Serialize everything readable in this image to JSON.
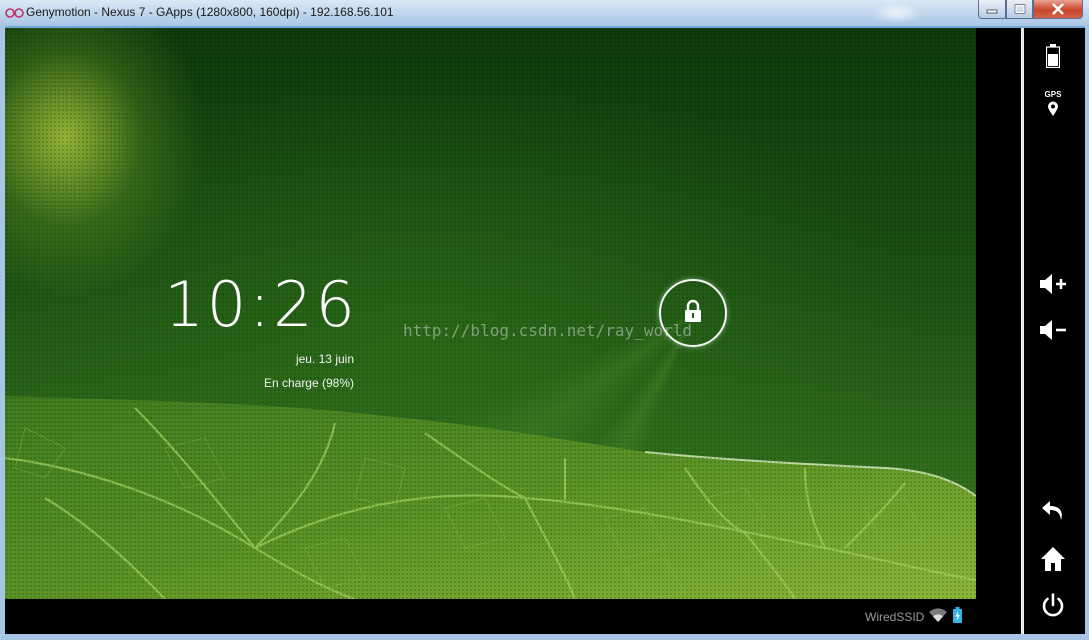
{
  "window": {
    "title": "Genymotion - Nexus 7 - GApps (1280x800, 160dpi) - 192.168.56.101"
  },
  "lockscreen": {
    "time": "10:26",
    "date": "jeu. 13 juin",
    "charging": "En charge (98%)",
    "watermark": "http://blog.csdn.net/ray_world"
  },
  "statusbar": {
    "ssid": "WiredSSID"
  },
  "sidebar": {
    "gps_label": "GPS"
  },
  "colors": {
    "titlebar": "#c4d8ee",
    "close_button": "#c9462c",
    "screen_green": "#1d5214",
    "sidebar_bg": "#000000"
  },
  "icons": [
    "genymotion-logo-icon",
    "minimize-icon",
    "maximize-icon",
    "close-icon",
    "lock-icon",
    "wifi-icon",
    "battery-charging-icon",
    "battery-icon",
    "gps-icon",
    "volume-up-icon",
    "volume-down-icon",
    "back-icon",
    "home-icon",
    "power-icon"
  ]
}
